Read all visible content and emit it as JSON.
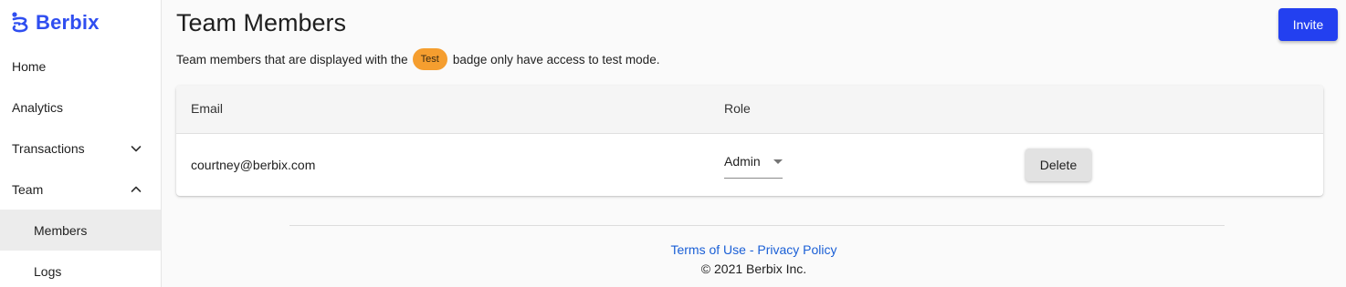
{
  "brand": {
    "name": "Berbix",
    "color": "#2f4ef0"
  },
  "sidebar": {
    "items": [
      {
        "label": "Home"
      },
      {
        "label": "Analytics"
      },
      {
        "label": "Transactions",
        "icon": "chevron-down-icon"
      },
      {
        "label": "Team",
        "icon": "chevron-up-icon"
      },
      {
        "label": "Members",
        "active": true
      },
      {
        "label": "Logs"
      }
    ]
  },
  "header": {
    "title": "Team Members",
    "invite_label": "Invite",
    "accent": "#2340f0"
  },
  "info": {
    "before": "Team members that are displayed with the",
    "badge": "Test",
    "after": "badge only have access to test mode.",
    "badge_color": "#f59e2f"
  },
  "table": {
    "columns": [
      "Email",
      "Role"
    ],
    "rows": [
      {
        "email": "courtney@berbix.com",
        "role": "Admin",
        "delete_label": "Delete"
      }
    ]
  },
  "footer": {
    "terms": "Terms of Use",
    "separator": "-",
    "privacy": "Privacy Policy",
    "copyright": "© 2021 Berbix Inc."
  }
}
